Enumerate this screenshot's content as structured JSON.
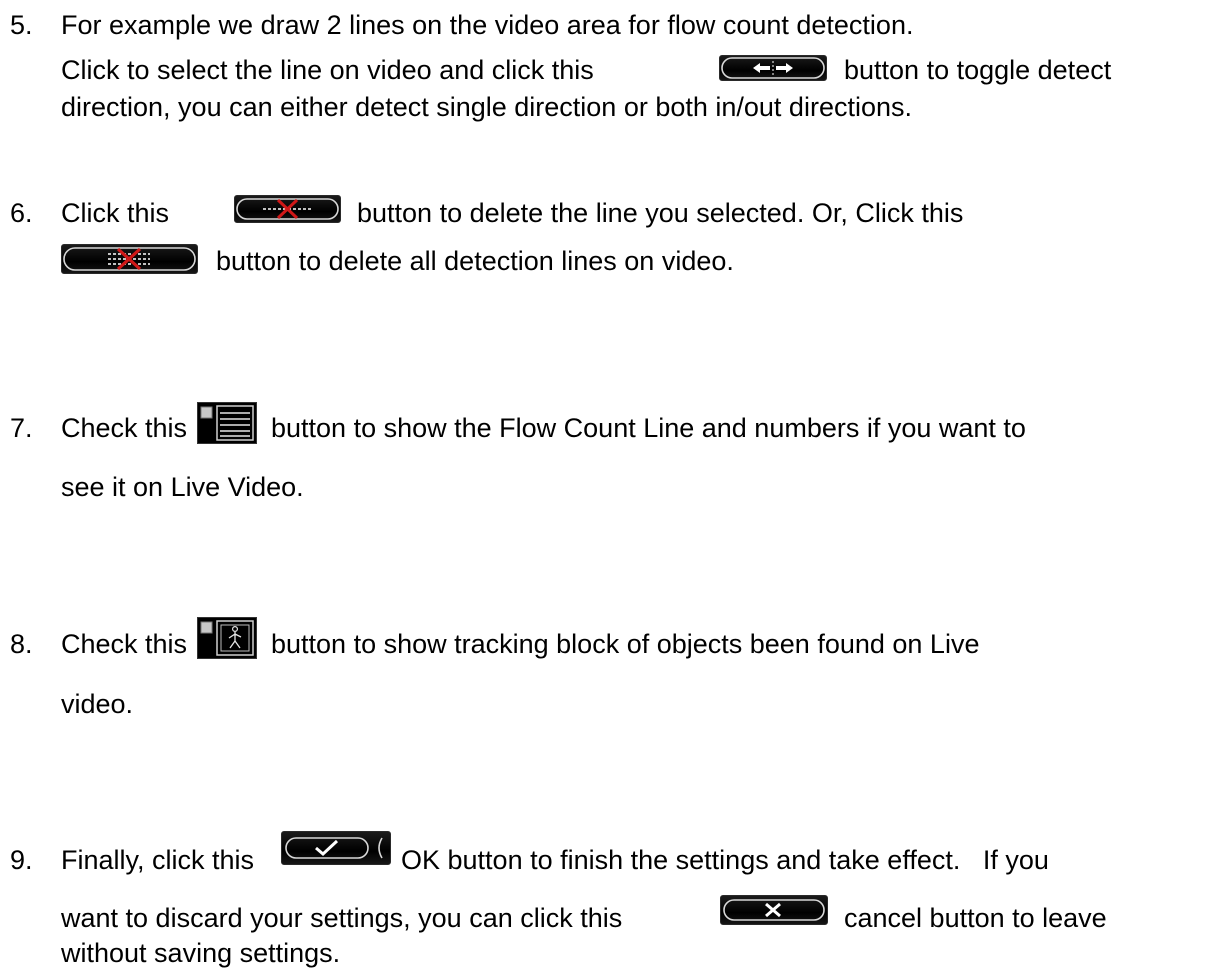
{
  "items": [
    {
      "number": "5.",
      "lines": [
        "For example we draw 2 lines on the video area for flow count detection.",
        [
          "Click to select the line on video and click this",
          "button to toggle detect"
        ],
        "direction, you can either detect single direction or both in/out directions."
      ],
      "icon": "toggle-direction-icon"
    },
    {
      "number": "6.",
      "lines": [
        [
          "Click this",
          "button to delete the line you selected. Or, Click this"
        ],
        [
          "",
          "button to delete all detection lines on video."
        ]
      ],
      "icons": [
        "delete-line-icon",
        "delete-all-lines-icon"
      ]
    },
    {
      "number": "7.",
      "lines": [
        [
          "Check this",
          "button to show the Flow Count Line and numbers if you want to"
        ],
        "see it on Live Video."
      ],
      "icon": "show-flow-count-checkbox-icon"
    },
    {
      "number": "8.",
      "lines": [
        [
          "Check this",
          "button to show tracking block of objects been found on Live"
        ],
        "video."
      ],
      "icon": "show-tracking-block-checkbox-icon"
    },
    {
      "number": "9.",
      "lines": [
        [
          "Finally, click this",
          "OK button to finish the settings and take effect.   If you"
        ],
        [
          "want to discard your settings, you can click this",
          "cancel button to leave"
        ],
        "without saving settings."
      ],
      "icons": [
        "ok-checkmark-icon",
        "cancel-x-icon"
      ]
    }
  ],
  "colors": {
    "text": "#000000",
    "icon_bg": "#000000",
    "icon_glyph": "#d8d8d8",
    "delete_x": "#d01818"
  }
}
